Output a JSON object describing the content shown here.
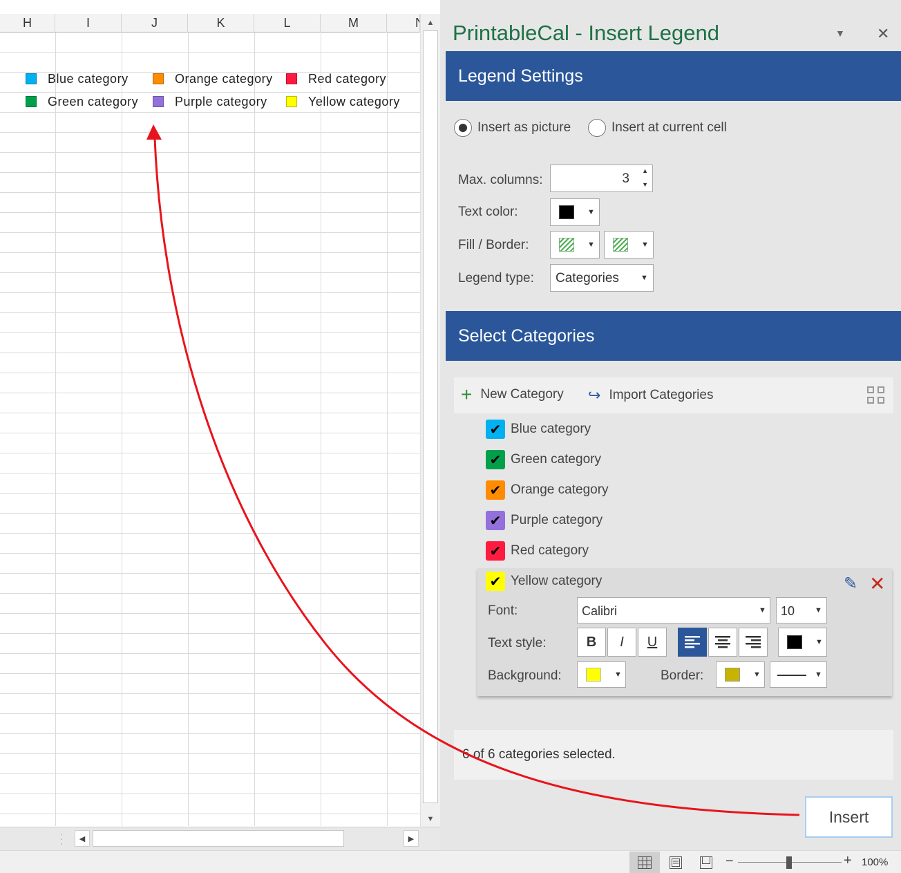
{
  "sheet": {
    "columns": [
      "H",
      "I",
      "J",
      "K",
      "L",
      "M",
      "N"
    ],
    "legend": [
      {
        "label": "Blue category",
        "color": "#00b0f0"
      },
      {
        "label": "Orange category",
        "color": "#ff8c00"
      },
      {
        "label": "Red category",
        "color": "#ff1a40"
      },
      {
        "label": "Green category",
        "color": "#00a04a"
      },
      {
        "label": "Purple category",
        "color": "#9370db"
      },
      {
        "label": "Yellow category",
        "color": "#ffff00"
      }
    ]
  },
  "pane": {
    "title": "PrintableCal - Insert Legend",
    "legend_settings": {
      "heading": "Legend Settings",
      "insert_as_picture": "Insert as picture",
      "insert_at_cell": "Insert at current cell",
      "max_columns_label": "Max. columns:",
      "max_columns_value": "3",
      "text_color_label": "Text color:",
      "fill_border_label": "Fill / Border:",
      "legend_type_label": "Legend type:",
      "legend_type_value": "Categories"
    },
    "select_categories": {
      "heading": "Select Categories",
      "new_category": "New Category",
      "import_categories": "Import Categories",
      "items": [
        {
          "label": "Blue category",
          "color": "#00b0f0"
        },
        {
          "label": "Green category",
          "color": "#00a04a"
        },
        {
          "label": "Orange category",
          "color": "#ff8c00"
        },
        {
          "label": "Purple category",
          "color": "#9370db"
        },
        {
          "label": "Red category",
          "color": "#ff1a40"
        },
        {
          "label": "Yellow category",
          "color": "#ffff00"
        }
      ],
      "editor": {
        "font_label": "Font:",
        "font_value": "Calibri",
        "size_value": "10",
        "text_style_label": "Text style:",
        "bold": "B",
        "italic": "I",
        "underline": "U",
        "background_label": "Background:",
        "background_color": "#ffff00",
        "border_label": "Border:",
        "border_color": "#c8b400"
      }
    },
    "status": "6 of 6 categories selected.",
    "insert_button": "Insert"
  },
  "statusbar": {
    "zoom": "100%"
  }
}
